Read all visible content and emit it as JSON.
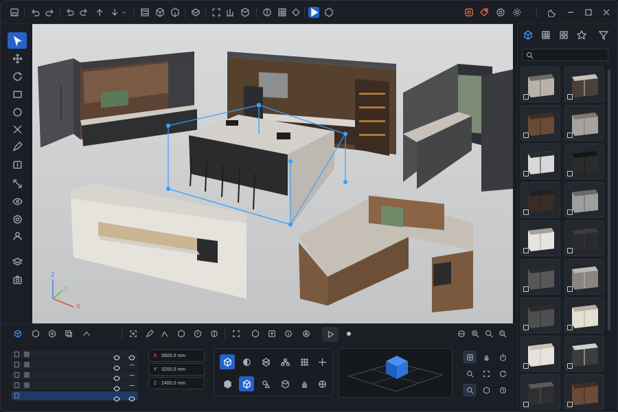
{
  "app": {
    "accent": "#2563c9",
    "highlight": "#3f8ef0",
    "danger": "#e8673a"
  },
  "toolbar": {
    "groups": [
      [
        "save-icon",
        "undo-icon",
        "redo-icon"
      ],
      [
        "undo-all-icon",
        "redo-all-icon",
        "import-icon",
        "export-icon"
      ],
      [
        "snap-icon",
        "box-icon",
        "cube-icon"
      ],
      [
        "scene-icon"
      ],
      [
        "select-region-icon",
        "measure-icon",
        "wireframe-icon"
      ],
      [
        "material-icon",
        "grid-icon",
        "pivot-icon"
      ],
      [
        "play-icon",
        "render-icon"
      ]
    ],
    "right": [
      "record-icon",
      "tag-icon",
      "settings-circle-icon",
      "gear-icon",
      "moon-icon",
      "minimize-icon",
      "maximize-icon",
      "close-icon"
    ]
  },
  "left_tools": [
    "select-tool",
    "move-tool",
    "rotate-tool",
    "rectangle-tool",
    "circle-tool",
    "cut-tool",
    "pencil-tool",
    "text-tool",
    "scale-tool",
    "visibility-tool",
    "orbit-tool",
    "user-tool",
    "layers-tool",
    "camera-tool"
  ],
  "viewport": {
    "axis": {
      "x": "X",
      "y": "Y",
      "z": "Z"
    }
  },
  "library": {
    "tabs": [
      "models-tab",
      "grid-tab",
      "components-tab",
      "favorites-tab",
      "filter-tab"
    ],
    "search_placeholder": "",
    "items": [
      "upper-cabinet",
      "kitchen-module",
      "base-cabinet",
      "drawer-unit",
      "sink-unit",
      "oven-unit",
      "dark-shelf",
      "tall-cabinet",
      "white-cabinet",
      "black-panel",
      "island-unit",
      "drawer-module",
      "range-unit",
      "cream-cabinet",
      "white-base",
      "cooktop",
      "open-shelf",
      "wood-cabinet"
    ]
  },
  "bottom": {
    "layers": [
      {
        "selected": false
      },
      {
        "selected": false
      },
      {
        "selected": false
      },
      {
        "selected": false
      },
      {
        "selected": true
      }
    ],
    "coords": [
      {
        "axis": "X",
        "value": "5800.0 mm",
        "color": "#e0504a"
      },
      {
        "axis": "Y",
        "value": "3200.0 mm",
        "color": "#57c25a"
      },
      {
        "axis": "Z",
        "value": "2400.0 mm",
        "color": "#4a86e8"
      }
    ]
  }
}
